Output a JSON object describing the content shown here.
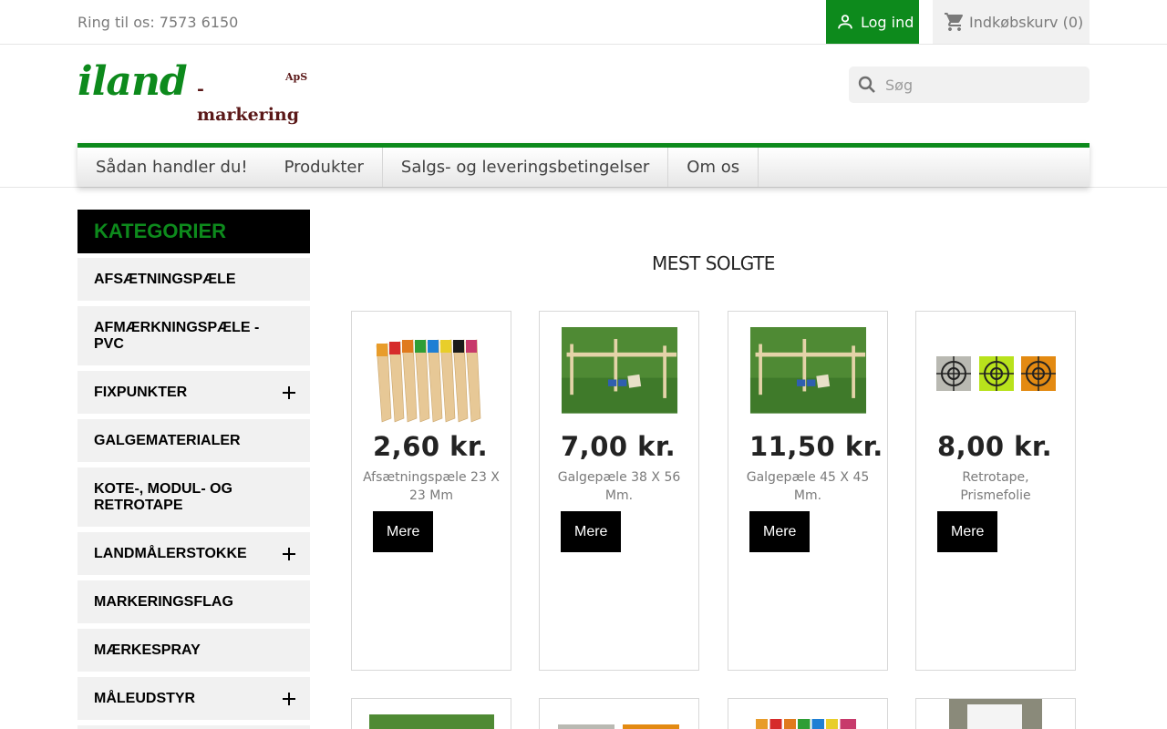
{
  "topbar": {
    "phone": "Ring til os: 7573 6150",
    "login_label": "Log ind",
    "cart_label": "Indkøbskurv (0)"
  },
  "header": {
    "logo_main": "iland",
    "logo_sub": "- markering",
    "logo_aps": "ApS",
    "search_placeholder": "Søg"
  },
  "nav": {
    "items": [
      "Sådan handler du!",
      "Produkter",
      "Salgs- og leveringsbetingelser",
      "Om os"
    ]
  },
  "sidebar": {
    "title": "KATEGORIER",
    "items": [
      {
        "label": "AFSÆTNINGSPÆLE",
        "expandable": false
      },
      {
        "label": "AFMÆRKNINGSPÆLE - PVC",
        "expandable": false
      },
      {
        "label": "FIXPUNKTER",
        "expandable": true
      },
      {
        "label": "GALGEMATERIALER",
        "expandable": false
      },
      {
        "label": "KOTE-, MODUL- OG RETROTAPE",
        "expandable": false
      },
      {
        "label": "LANDMÅLERSTOKKE",
        "expandable": true
      },
      {
        "label": "MARKERINGSFLAG",
        "expandable": false
      },
      {
        "label": "MÆRKESPRAY",
        "expandable": false
      },
      {
        "label": "MÅLEUDSTYR",
        "expandable": true
      }
    ]
  },
  "main": {
    "section_title": "MEST SOLGTE",
    "products": [
      {
        "price": "2,60 kr.",
        "name": "Afsætningspæle 23 X 23 Mm",
        "button": "Mere",
        "image": "colored-stakes"
      },
      {
        "price": "7,00 kr.",
        "name": "Galgepæle 38 X 56 Mm.",
        "button": "Mere",
        "image": "batter-board-grass"
      },
      {
        "price": "11,50 kr.",
        "name": "Galgepæle 45 X 45 Mm.",
        "button": "Mere",
        "image": "batter-board-grass"
      },
      {
        "price": "8,00 kr.",
        "name": "Retrotape, Prismefolie",
        "button": "Mere",
        "image": "target-stickers"
      }
    ]
  },
  "colors": {
    "brand_green": "#0d8a1c",
    "logo_brown": "#5a1717",
    "black": "#000000"
  }
}
